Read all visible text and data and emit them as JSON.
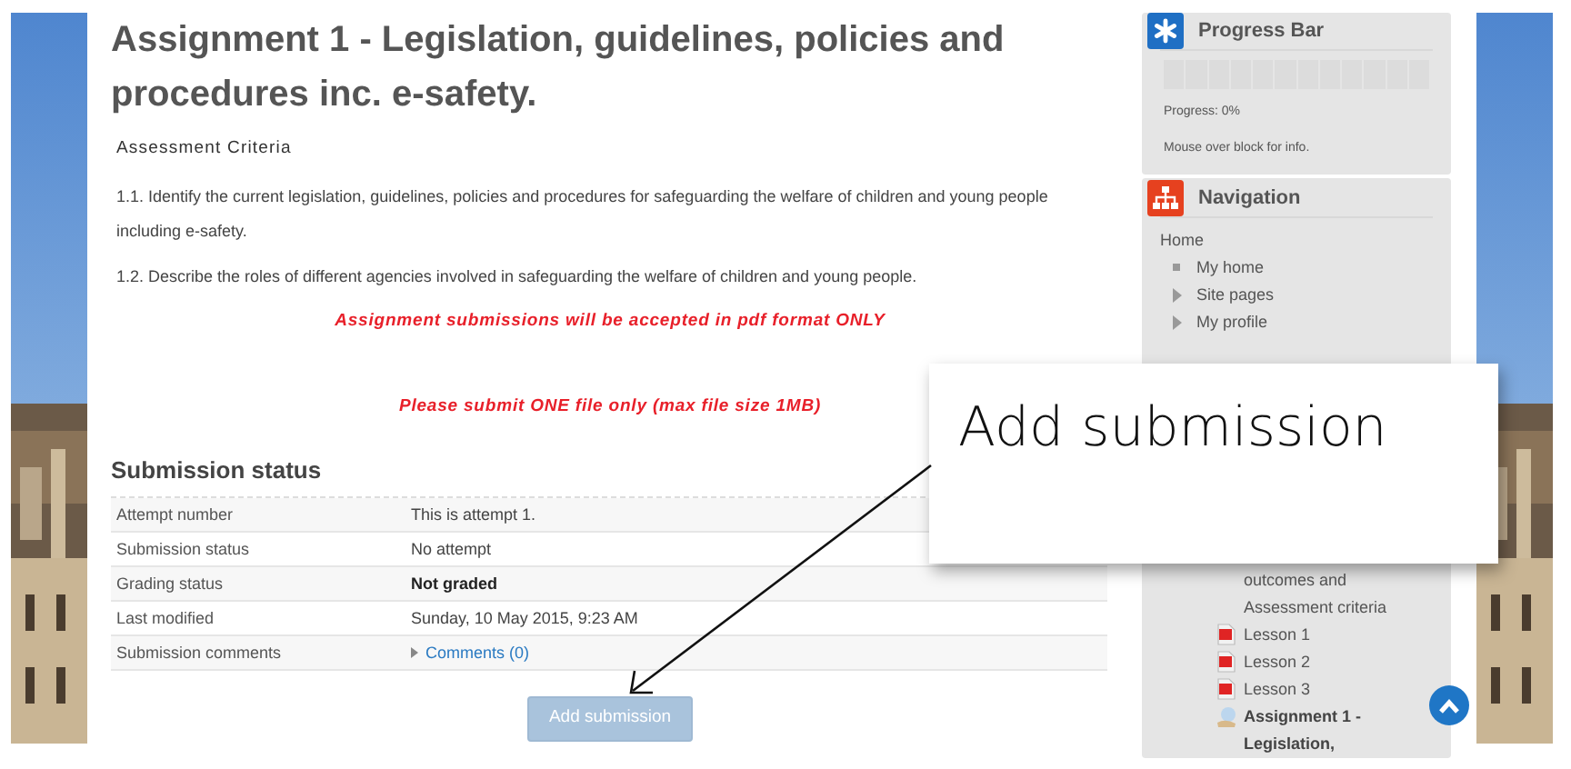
{
  "assignment": {
    "title": "Assignment 1 - Legislation, guidelines, policies and procedures inc. e-safety.",
    "criteria_heading": "Assessment Criteria",
    "criteria": [
      "1.1. Identify the current legislation, guidelines, policies and procedures for safeguarding the welfare of children and young people including e-safety.",
      "1.2. Describe the roles of different agencies involved in safeguarding the welfare of children and young people."
    ],
    "notices": [
      "Assignment submissions will be accepted in pdf format ONLY",
      "Please submit ONE file only (max file size 1MB)"
    ]
  },
  "submission_status": {
    "heading": "Submission status",
    "rows": [
      {
        "label": "Attempt number",
        "value": "This is attempt 1.",
        "kind": "text"
      },
      {
        "label": "Submission status",
        "value": "No attempt",
        "kind": "text"
      },
      {
        "label": "Grading status",
        "value": "Not graded",
        "kind": "bold"
      },
      {
        "label": "Last modified",
        "value": "Sunday, 10 May 2015, 9:23 AM",
        "kind": "text"
      },
      {
        "label": "Submission comments",
        "value": "Comments (0)",
        "kind": "link"
      }
    ]
  },
  "add_submission_button": {
    "label": "Add submission"
  },
  "sidebar": {
    "blocks": [
      {
        "kind": "progress",
        "title": "Progress Bar",
        "progress_text": "Progress: 0%",
        "hint": "Mouse over block for info."
      },
      {
        "kind": "navigation",
        "title": "Navigation",
        "items": [
          {
            "label": "Home",
            "children": [
              {
                "label": "My home",
                "kind": "leaf"
              },
              {
                "label": "Site pages",
                "kind": "branch"
              },
              {
                "label": "My profile",
                "kind": "branch"
              }
            ]
          }
        ],
        "course_items": [
          {
            "label": "outcomes and Assessment criteria",
            "kind": "text"
          },
          {
            "label": "Lesson 1",
            "kind": "pdf"
          },
          {
            "label": "Lesson 2",
            "kind": "pdf"
          },
          {
            "label": "Lesson 3",
            "kind": "pdf"
          },
          {
            "label": "Assignment 1 - Legislation,",
            "kind": "assignment"
          }
        ]
      }
    ]
  },
  "callout": {
    "text": "Add submission"
  }
}
